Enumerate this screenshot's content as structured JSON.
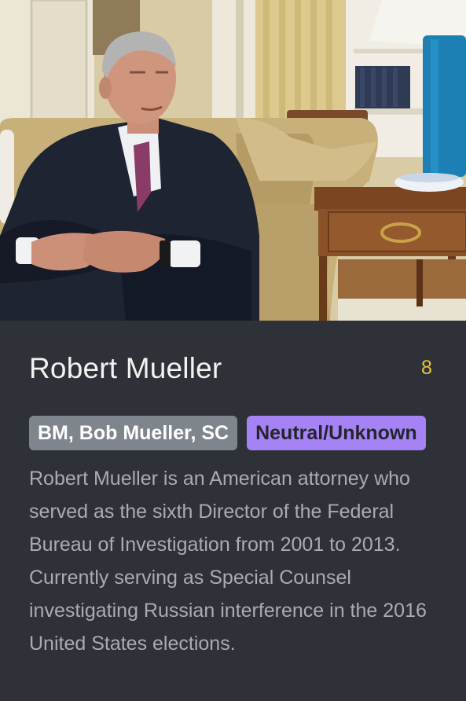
{
  "profile": {
    "name": "Robert Mueller",
    "count": "8",
    "aliases": "BM, Bob Mueller, SC",
    "stance": "Neutral/Unknown",
    "description": "Robert Mueller is an American attorney who served as the sixth Director of the Federal Bureau of Investigation from 2001 to 2013.  Currently serving as Special Counsel investigating Russian interference in the 2016 United States elections."
  },
  "colors": {
    "background": "#2e3138",
    "count": "#e8c23b",
    "alias_tag": "#7f858c",
    "stance_tag": "#a583f5"
  },
  "icons": {
    "photo": "portrait-photo"
  }
}
